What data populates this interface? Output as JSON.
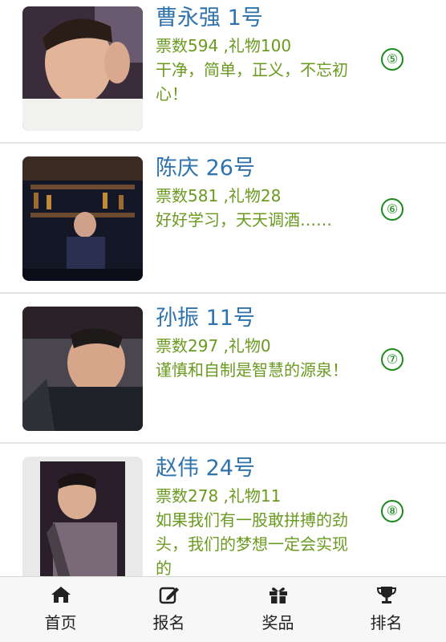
{
  "contestants": [
    {
      "name": "曹永强 1号",
      "stats": "票数594 ,礼物100",
      "motto": "干净，简单，正义，不忘初心！",
      "rank": "⑤",
      "photo": "contestant-photo-1"
    },
    {
      "name": "陈庆 26号",
      "stats": "票数581 ,礼物28",
      "motto": "好好学习，天天调酒……",
      "rank": "⑥",
      "photo": "contestant-photo-26"
    },
    {
      "name": "孙振 11号",
      "stats": "票数297 ,礼物0",
      "motto": "谨慎和自制是智慧的源泉！",
      "rank": "⑦",
      "photo": "contestant-photo-11"
    },
    {
      "name": "赵伟 24号",
      "stats": "票数278 ,礼物11",
      "motto": "如果我们有一股敢拼搏的劲头，我们的梦想一定会实现的",
      "rank": "⑧",
      "photo": "contestant-photo-24"
    }
  ],
  "tabbar": {
    "home": {
      "label": "首页",
      "icon": "home-icon"
    },
    "signup": {
      "label": "报名",
      "icon": "edit-icon"
    },
    "prizes": {
      "label": "奖品",
      "icon": "gift-icon"
    },
    "ranking": {
      "label": "排名",
      "icon": "trophy-icon"
    }
  },
  "colors": {
    "name": "#2f73ad",
    "text": "#6a9a1f",
    "rank": "#1a8a1a"
  }
}
